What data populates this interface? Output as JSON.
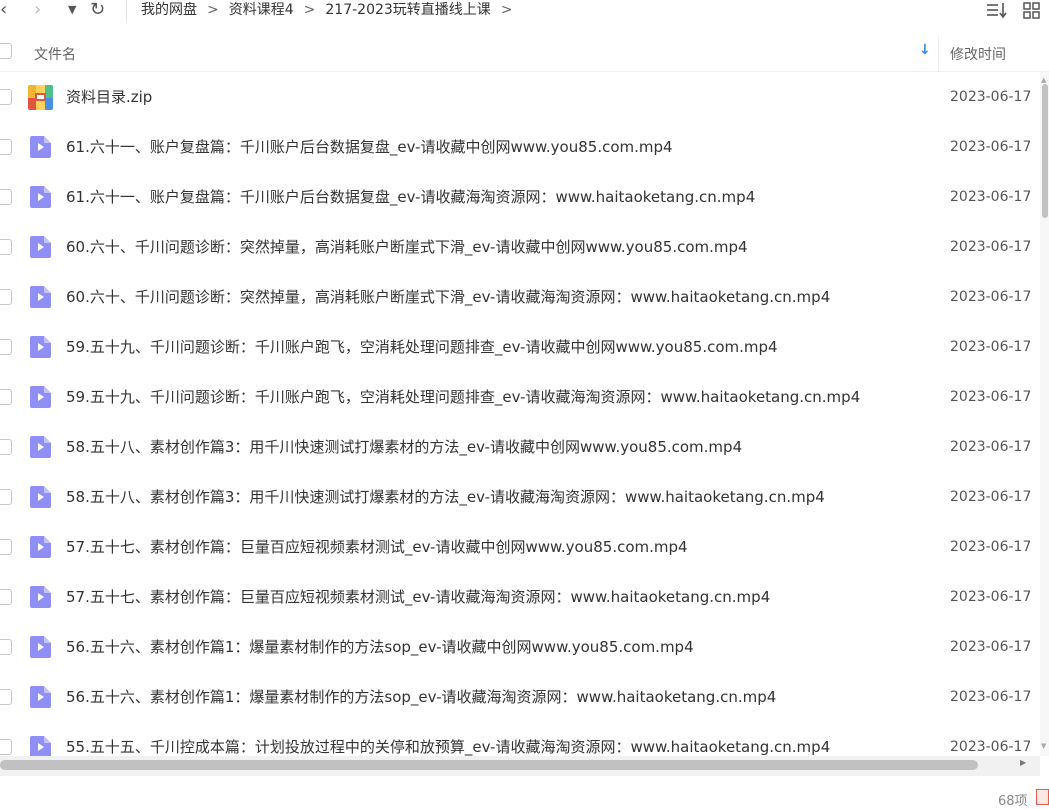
{
  "toolbar": {
    "back_glyph": "‹",
    "forward_glyph": "›",
    "dropdown_glyph": "▼",
    "refresh_glyph": "↻",
    "icons": [
      "back-icon",
      "forward-icon",
      "dropdown-icon",
      "refresh-icon",
      "sort-list-icon",
      "grid-view-icon"
    ]
  },
  "breadcrumb": {
    "items": [
      "我的网盘",
      "资料课程4",
      "217-2023玩转直播线上课"
    ],
    "separator": ">"
  },
  "header": {
    "name_label": "文件名",
    "sort_arrow": "↓",
    "mtime_label": "修改时间",
    "accent_color": "#2f8cf0"
  },
  "files": [
    {
      "name": "资料目录.zip",
      "modified": "2023-06-17",
      "type": "zip"
    },
    {
      "name": "61.六十一、账户复盘篇：千川账户后台数据复盘_ev-请收藏中创网www.you85.com.mp4",
      "modified": "2023-06-17",
      "type": "video"
    },
    {
      "name": "61.六十一、账户复盘篇：千川账户后台数据复盘_ev-请收藏海淘资源网：www.haitaoketang.cn.mp4",
      "modified": "2023-06-17",
      "type": "video"
    },
    {
      "name": "60.六十、千川问题诊断：突然掉量，高消耗账户断崖式下滑_ev-请收藏中创网www.you85.com.mp4",
      "modified": "2023-06-17",
      "type": "video"
    },
    {
      "name": "60.六十、千川问题诊断：突然掉量，高消耗账户断崖式下滑_ev-请收藏海淘资源网：www.haitaoketang.cn.mp4",
      "modified": "2023-06-17",
      "type": "video"
    },
    {
      "name": "59.五十九、千川问题诊断：千川账户跑飞，空消耗处理问题排查_ev-请收藏中创网www.you85.com.mp4",
      "modified": "2023-06-17",
      "type": "video"
    },
    {
      "name": "59.五十九、千川问题诊断：千川账户跑飞，空消耗处理问题排查_ev-请收藏海淘资源网：www.haitaoketang.cn.mp4",
      "modified": "2023-06-17",
      "type": "video"
    },
    {
      "name": "58.五十八、素材创作篇3：用千川快速测试打爆素材的方法_ev-请收藏中创网www.you85.com.mp4",
      "modified": "2023-06-17",
      "type": "video"
    },
    {
      "name": "58.五十八、素材创作篇3：用千川快速测试打爆素材的方法_ev-请收藏海淘资源网：www.haitaoketang.cn.mp4",
      "modified": "2023-06-17",
      "type": "video"
    },
    {
      "name": "57.五十七、素材创作篇：巨量百应短视频素材测试_ev-请收藏中创网www.you85.com.mp4",
      "modified": "2023-06-17",
      "type": "video"
    },
    {
      "name": "57.五十七、素材创作篇：巨量百应短视频素材测试_ev-请收藏海淘资源网：www.haitaoketang.cn.mp4",
      "modified": "2023-06-17",
      "type": "video"
    },
    {
      "name": "56.五十六、素材创作篇1：爆量素材制作的方法sop_ev-请收藏中创网www.you85.com.mp4",
      "modified": "2023-06-17",
      "type": "video"
    },
    {
      "name": "56.五十六、素材创作篇1：爆量素材制作的方法sop_ev-请收藏海淘资源网：www.haitaoketang.cn.mp4",
      "modified": "2023-06-17",
      "type": "video"
    },
    {
      "name": "55.五十五、千川控成本篇：计划投放过程中的关停和放预算_ev-请收藏海淘资源网：www.haitaoketang.cn.mp4",
      "modified": "2023-06-17",
      "type": "video"
    }
  ],
  "status": {
    "item_count": "68项"
  },
  "colors": {
    "video_icon": "#8f8ff5",
    "zip_top_left": "#f3b431",
    "zip_top_right": "#4fc08d",
    "zip_bottom_left": "#e0553f",
    "zip_bottom_right": "#4a90e2"
  }
}
